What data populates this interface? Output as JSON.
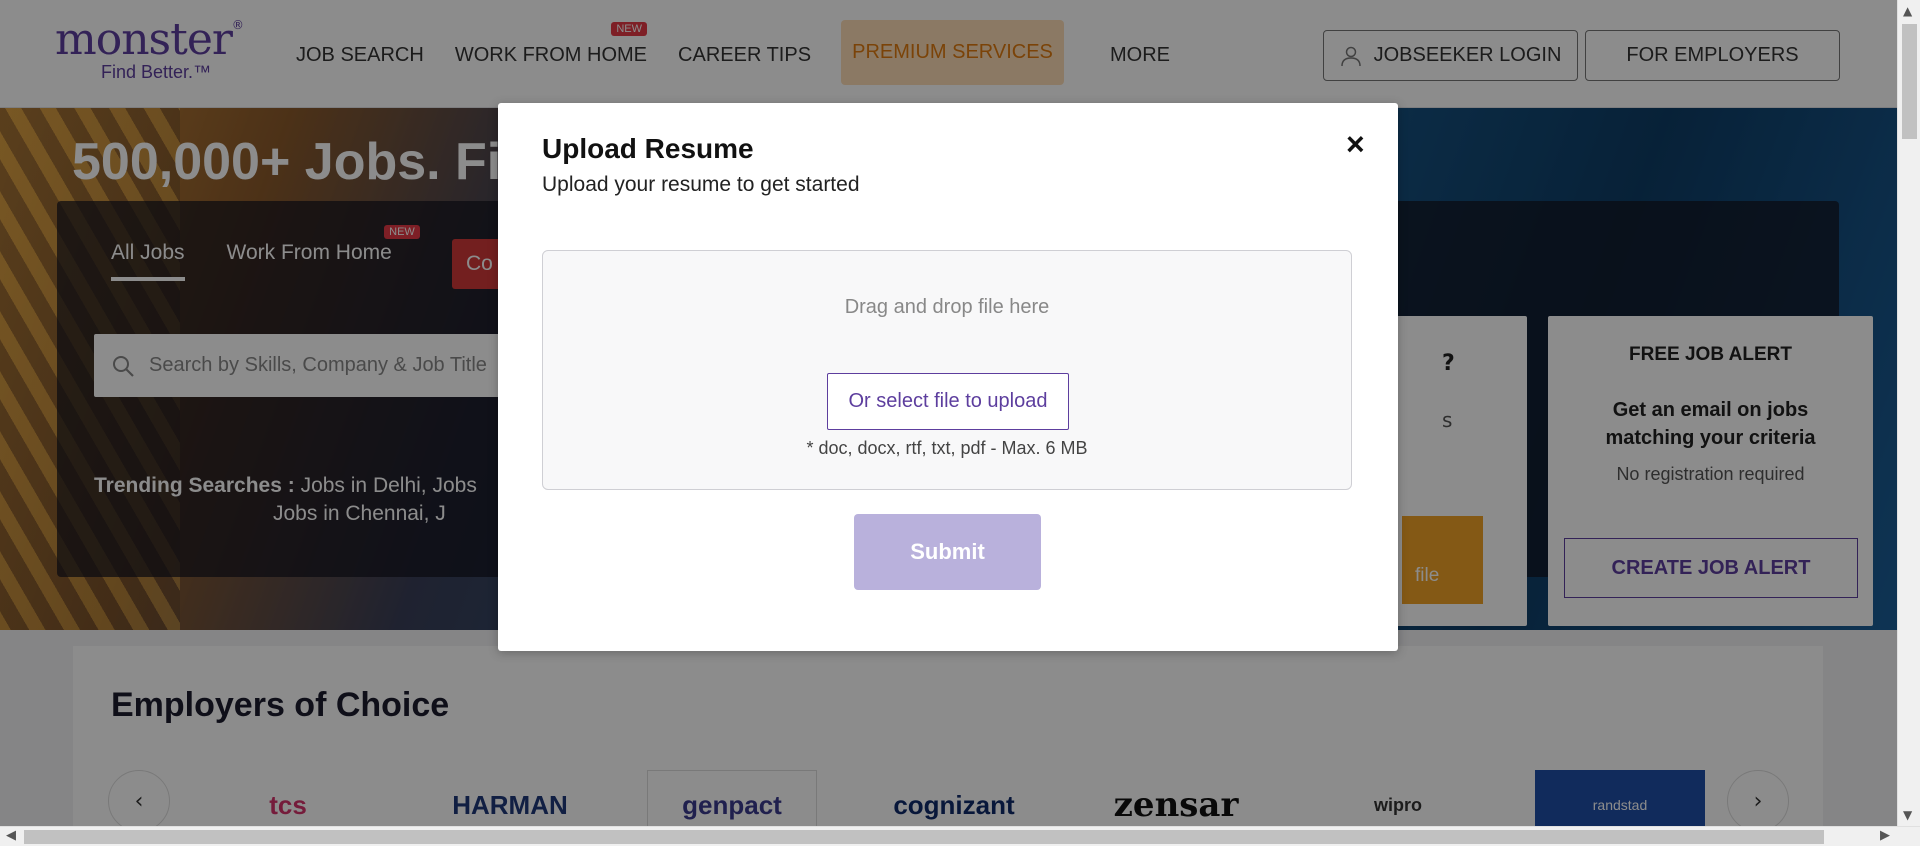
{
  "header": {
    "logo_word": "monster",
    "logo_tagline": "Find Better.™",
    "nav": [
      {
        "label": "JOB SEARCH",
        "badge": ""
      },
      {
        "label": "WORK FROM HOME",
        "badge": "NEW"
      },
      {
        "label": "CAREER TIPS",
        "badge": ""
      }
    ],
    "premium_label": "PREMIUM SERVICES",
    "more_label": "MORE",
    "login_label": "JOBSEEKER LOGIN",
    "employers_label": "FOR EMPLOYERS"
  },
  "hero": {
    "title": "500,000+ Jobs. Fi",
    "tabs": [
      {
        "label": "All Jobs",
        "badge": ""
      },
      {
        "label": "Work From Home",
        "badge": "NEW"
      }
    ],
    "red_tab_label": "Co",
    "search_placeholder": "Search by Skills, Company & Job Title",
    "trending_label": "Trending Searches :",
    "trending_line1": "Jobs in Delhi, Jobs",
    "trending_line2": "Jobs in Chennai, J",
    "mid_card_q": "?",
    "mid_card_s": "s",
    "mid_card_btn": "file",
    "alert_title": "FREE JOB ALERT",
    "alert_body": "Get an email on jobs matching your criteria",
    "alert_note": "No registration required",
    "alert_button": "CREATE JOB ALERT"
  },
  "employers": {
    "title": "Employers of Choice",
    "prev": "‹",
    "next": "›",
    "logos": [
      {
        "name": "tcs",
        "color": "#d6336c"
      },
      {
        "name": "HARMAN",
        "color": "#1f3a7a"
      },
      {
        "name": "genpact",
        "color": "#3b3b8f"
      },
      {
        "name": "cognizant",
        "color": "#0f2b6b"
      },
      {
        "name": "zensar",
        "color": "#111111"
      },
      {
        "name": "wipro",
        "color": "#333333"
      },
      {
        "name": "randstad",
        "color": "#1f4fa8"
      }
    ]
  },
  "modal": {
    "title": "Upload Resume",
    "subtitle": "Upload your resume to get started",
    "close": "×",
    "drop_text": "Drag and drop file here",
    "select_label": "Or select file to upload",
    "file_note": "* doc, docx, rtf, txt, pdf - Max. 6 MB",
    "submit_label": "Submit"
  },
  "colors": {
    "brand": "#5d3e9e",
    "premium_bg": "#fdddb7",
    "premium_text": "#e07b0f",
    "badge_red": "#e53945",
    "submit_disabled": "#b9b1dc"
  }
}
